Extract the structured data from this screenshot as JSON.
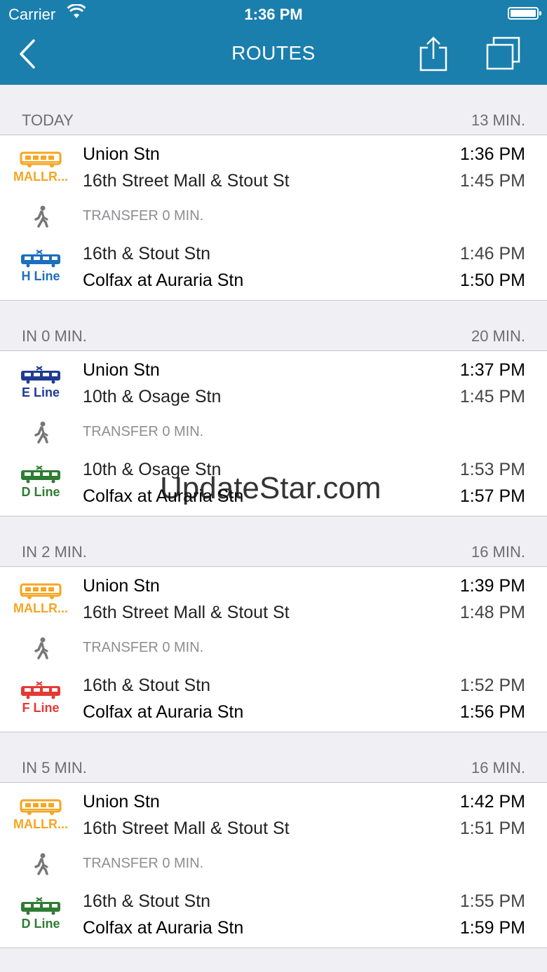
{
  "status_bar": {
    "carrier": "Carrier",
    "time": "1:36 PM"
  },
  "nav": {
    "title": "ROUTES"
  },
  "routes": [
    {
      "depart": "TODAY",
      "duration": "13 MIN.",
      "legs": [
        {
          "line": "MALLR...",
          "color": "#f5a623",
          "type": "bus",
          "from": "Union Stn",
          "to": "16th Street Mall & Stout St",
          "dep": "1:36 PM",
          "arr": "1:45 PM"
        },
        {
          "line": "H Line",
          "color": "#1b6fbd",
          "type": "rail",
          "from": "16th & Stout Stn",
          "to": "Colfax at Auraria Stn",
          "dep": "1:46 PM",
          "arr": "1:50 PM"
        }
      ],
      "transfer": "TRANSFER 0 MIN."
    },
    {
      "depart": "IN 0 MIN.",
      "duration": "20 MIN.",
      "legs": [
        {
          "line": "E Line",
          "color": "#1f3a93",
          "type": "rail",
          "from": "Union Stn",
          "to": "10th & Osage Stn",
          "dep": "1:37 PM",
          "arr": "1:45 PM"
        },
        {
          "line": "D Line",
          "color": "#2e7d32",
          "type": "rail",
          "from": "10th & Osage Stn",
          "to": "Colfax at Auraria Stn",
          "dep": "1:53 PM",
          "arr": "1:57 PM"
        }
      ],
      "transfer": "TRANSFER 0 MIN."
    },
    {
      "depart": "IN 2 MIN.",
      "duration": "16 MIN.",
      "legs": [
        {
          "line": "MALLR...",
          "color": "#f5a623",
          "type": "bus",
          "from": "Union Stn",
          "to": "16th Street Mall & Stout St",
          "dep": "1:39 PM",
          "arr": "1:48 PM"
        },
        {
          "line": "F Line",
          "color": "#e53935",
          "type": "rail",
          "from": "16th & Stout Stn",
          "to": "Colfax at Auraria Stn",
          "dep": "1:52 PM",
          "arr": "1:56 PM"
        }
      ],
      "transfer": "TRANSFER 0 MIN."
    },
    {
      "depart": "IN 5 MIN.",
      "duration": "16 MIN.",
      "legs": [
        {
          "line": "MALLR...",
          "color": "#f5a623",
          "type": "bus",
          "from": "Union Stn",
          "to": "16th Street Mall & Stout St",
          "dep": "1:42 PM",
          "arr": "1:51 PM"
        },
        {
          "line": "D Line",
          "color": "#2e7d32",
          "type": "rail",
          "from": "16th & Stout Stn",
          "to": "Colfax at Auraria Stn",
          "dep": "1:55 PM",
          "arr": "1:59 PM"
        }
      ],
      "transfer": "TRANSFER 0 MIN."
    }
  ],
  "watermark": "UpdateStar.com"
}
